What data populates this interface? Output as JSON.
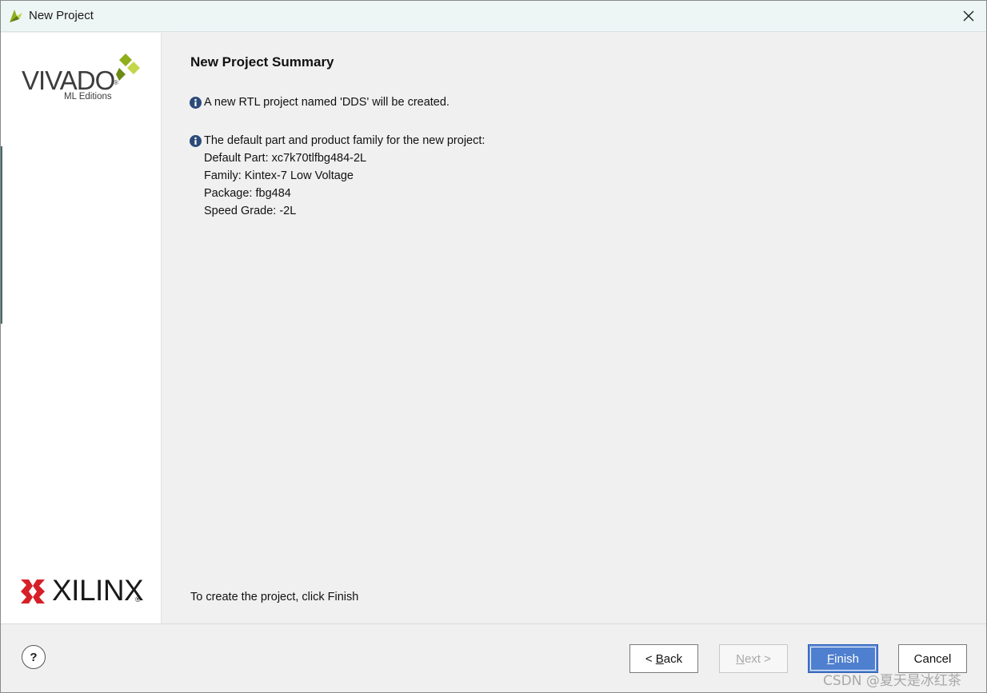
{
  "window": {
    "title": "New Project"
  },
  "sidebar": {
    "vivado_logo_text": "VIVADO",
    "vivado_logo_registered": "®",
    "vivado_logo_sub": "ML Editions",
    "xilinx_logo_text": "XILINX",
    "xilinx_logo_registered": "®"
  },
  "main": {
    "heading": "New Project Summary",
    "message1": "A new RTL project named 'DDS' will be created.",
    "message2_intro": "The default part and product family for the new project:",
    "default_part": "Default Part: xc7k70tlfbg484-2L",
    "family": "Family: Kintex-7 Low Voltage",
    "package": "Package: fbg484",
    "speed_grade": "Speed Grade: -2L",
    "footer_instruction": "To create the project, click Finish"
  },
  "buttons": {
    "help": "?",
    "back_prefix": "< ",
    "back_mnemonic": "B",
    "back_rest": "ack",
    "next_mnemonic": "N",
    "next_rest": "ext >",
    "finish_mnemonic": "F",
    "finish_rest": "inish",
    "cancel": "Cancel"
  },
  "watermark": "CSDN @夏天是冰红茶",
  "colors": {
    "finish_button": "#4f7fcf",
    "info_icon": "#2b4a7a",
    "vivado_accent": "#8fae1b",
    "xilinx_red": "#d62027"
  },
  "icons": {
    "window": "vivado-app-icon",
    "close": "close-icon",
    "info": "info-icon"
  }
}
